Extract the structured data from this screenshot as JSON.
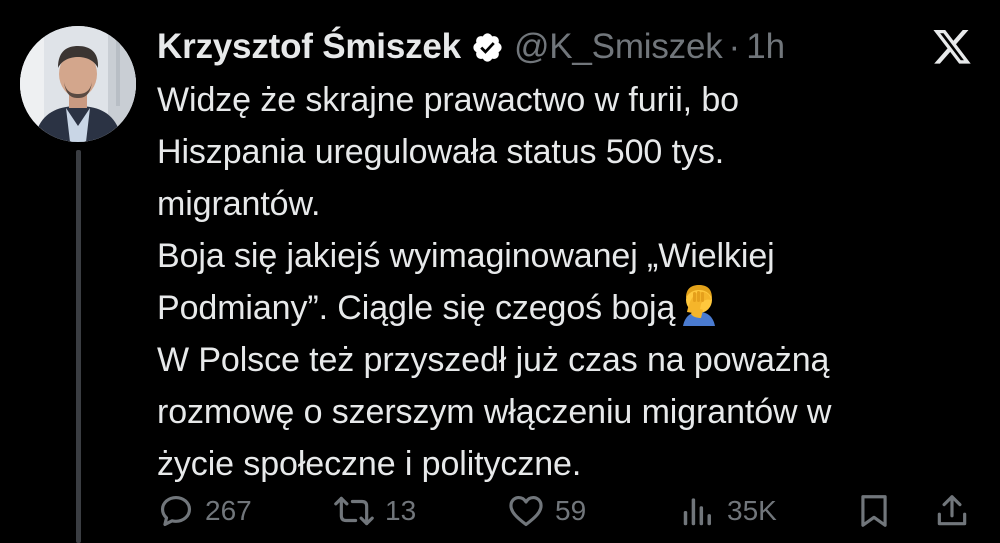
{
  "author": {
    "name": "Krzysztof Śmiszek",
    "handle": "@K_Smiszek",
    "separator": "·",
    "time": "1h"
  },
  "icons": {
    "avatar": "avatar",
    "verified": "verified-badge-icon",
    "platform": "x-logo-icon",
    "emoji": "face-palm-emoji",
    "reply": "reply-icon",
    "repost": "repost-icon",
    "like": "heart-icon",
    "views": "views-icon",
    "bookmark": "bookmark-icon",
    "share": "share-icon"
  },
  "tweet": {
    "lines": [
      "Widzę że skrajne prawactwo w furii, bo",
      "Hiszpania uregulowała status 500 tys.",
      "migrantów.",
      "Boja się jakiejś wyimaginowanej „Wielkiej",
      "Podmiany”. Ciągle się czegoś boją",
      "W Polsce też przyszedł już czas na poważną",
      "rozmowę o szerszym włączeniu migrantów w",
      "życie społeczne i polityczne."
    ]
  },
  "metrics": {
    "replies": "267",
    "reposts": "13",
    "likes": "59",
    "views": "35K"
  },
  "colors": {
    "background": "#000000",
    "text": "#e7e9ea",
    "muted": "#71767b",
    "verified": "#ffffff"
  }
}
